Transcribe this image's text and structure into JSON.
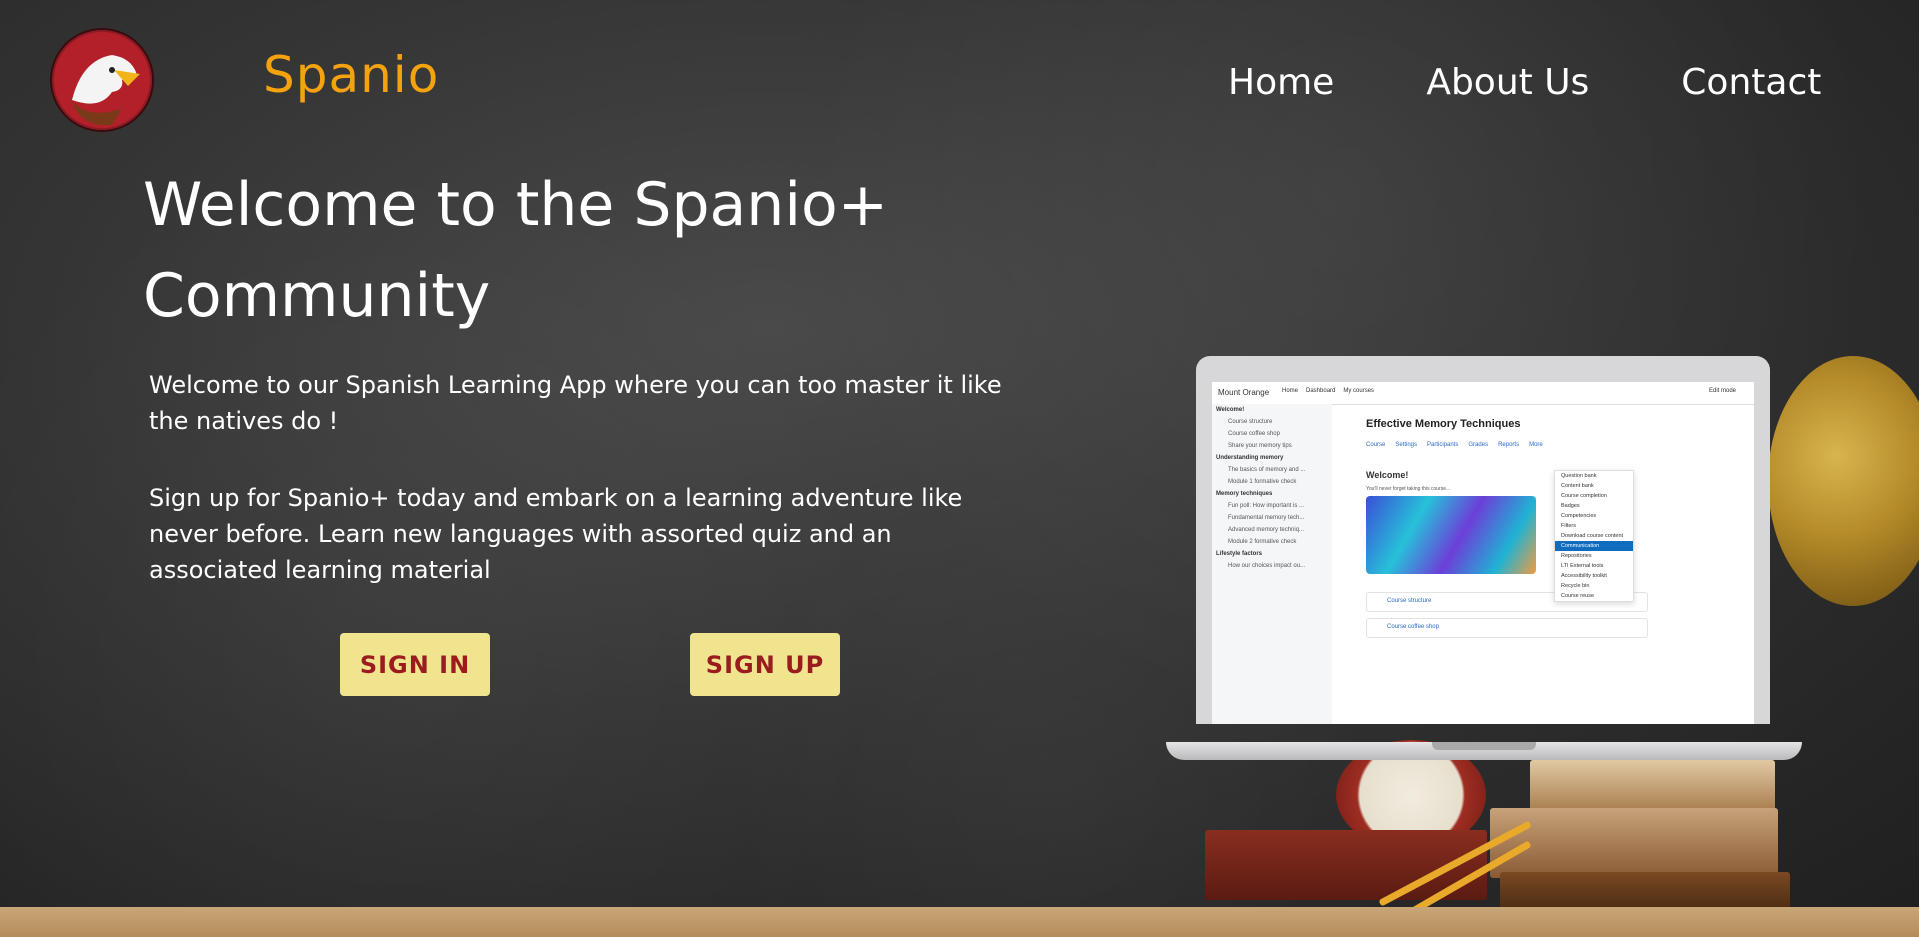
{
  "brand": {
    "name": "Spanio"
  },
  "nav": {
    "home": "Home",
    "about": "About Us",
    "contact": "Contact"
  },
  "hero": {
    "headline": "Welcome to the Spanio+ Community",
    "intro": "Welcome to our Spanish Learning App where you can too master it like the natives do !",
    "description": "Sign up for Spanio+ today and embark on a learning adventure like never before. Learn new languages with assorted quiz and an associated learning material"
  },
  "buttons": {
    "sign_in": "SIGN IN",
    "sign_up": "SIGN UP"
  },
  "laptop": {
    "site_name": "Mount Orange",
    "top_menu": [
      "Home",
      "Dashboard",
      "My courses"
    ],
    "edit_mode": "Edit mode",
    "sidebar": [
      {
        "label": "Welcome!",
        "type": "section"
      },
      {
        "label": "Course structure",
        "type": "item"
      },
      {
        "label": "Course coffee shop",
        "type": "item"
      },
      {
        "label": "Share your memory tips",
        "type": "item"
      },
      {
        "label": "Understanding memory",
        "type": "section"
      },
      {
        "label": "The basics of memory and ...",
        "type": "item"
      },
      {
        "label": "Module 1 formative check",
        "type": "item"
      },
      {
        "label": "Memory techniques",
        "type": "section"
      },
      {
        "label": "Fun poll: How important is ...",
        "type": "item"
      },
      {
        "label": "Fundamental memory tech...",
        "type": "item"
      },
      {
        "label": "Advanced memory techniq...",
        "type": "item"
      },
      {
        "label": "Module 2 formative check",
        "type": "item"
      },
      {
        "label": "Lifestyle factors",
        "type": "section"
      },
      {
        "label": "How our choices impact ou...",
        "type": "item"
      }
    ],
    "course_title": "Effective Memory Techniques",
    "tabs": [
      "Course",
      "Settings",
      "Participants",
      "Grades",
      "Reports",
      "More"
    ],
    "section_title": "Welcome!",
    "section_sub": "You'll never forget taking this course...",
    "activities": [
      "Course structure",
      "Course coffee shop"
    ],
    "more_menu": [
      "Question bank",
      "Content bank",
      "Course completion",
      "Badges",
      "Competencies",
      "Filters",
      "Download course content",
      "Communication",
      "Repositories",
      "LTI External tools",
      "Accessibility toolkit",
      "Recycle bin",
      "Course reuse"
    ],
    "more_selected": "Communication"
  }
}
